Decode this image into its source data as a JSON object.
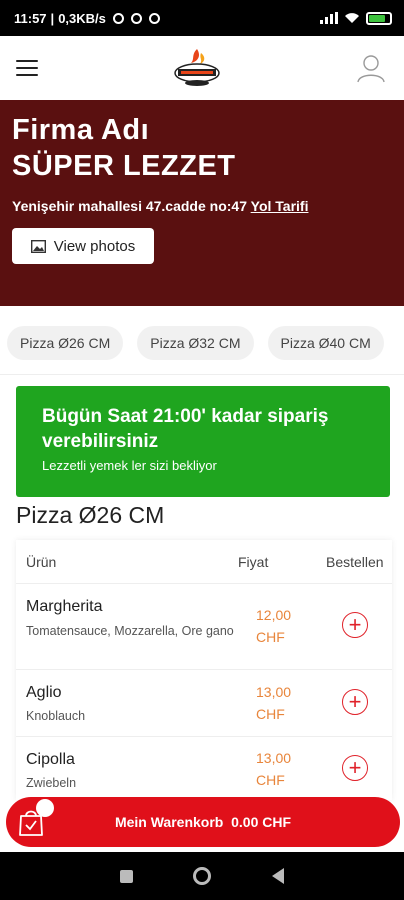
{
  "statusbar": {
    "time": "11:57",
    "network": "0,3KB/s",
    "battery": "96"
  },
  "header": {
    "logo_icon": "restaurant-logo-icon",
    "menu_icon": "hamburger-icon",
    "profile_icon": "user-icon"
  },
  "hero": {
    "title_line1": "Firma Adı",
    "title_line2": "SÜPER LEZZET",
    "address": "Yenişehir mahallesi 47.cadde no:47",
    "directions_link": "Yol Tarifi",
    "photos_button": "View photos",
    "background_color": "#5a1010"
  },
  "tabs": [
    {
      "label": "Pizza Ø26 CM"
    },
    {
      "label": "Pizza Ø32 CM"
    },
    {
      "label": "Pizza Ø40 CM"
    }
  ],
  "banner": {
    "title": "Bügün Saat 21:00' kadar sipariş verebilirsiniz",
    "subtitle": "Lezzetli yemek ler sizi bekliyor",
    "color": "#1fa51f"
  },
  "section": {
    "title": "Pizza Ø26 CM"
  },
  "table": {
    "headers": {
      "product": "Ürün",
      "price": "Fiyat",
      "order": "Bestellen"
    },
    "rows": [
      {
        "name": "Margherita",
        "desc": "Tomatensauce, Mozzarella, Ore gano",
        "price": "12,00",
        "currency": "CHF"
      },
      {
        "name": "Aglio",
        "desc": "Knoblauch",
        "price": "13,00",
        "currency": "CHF"
      },
      {
        "name": "Cipolla",
        "desc": "Zwiebeln",
        "price": "13,00",
        "currency": "CHF"
      }
    ]
  },
  "cart": {
    "label": "Mein Warenkorb",
    "total": "0.00 CHF",
    "color": "#e0101a"
  }
}
